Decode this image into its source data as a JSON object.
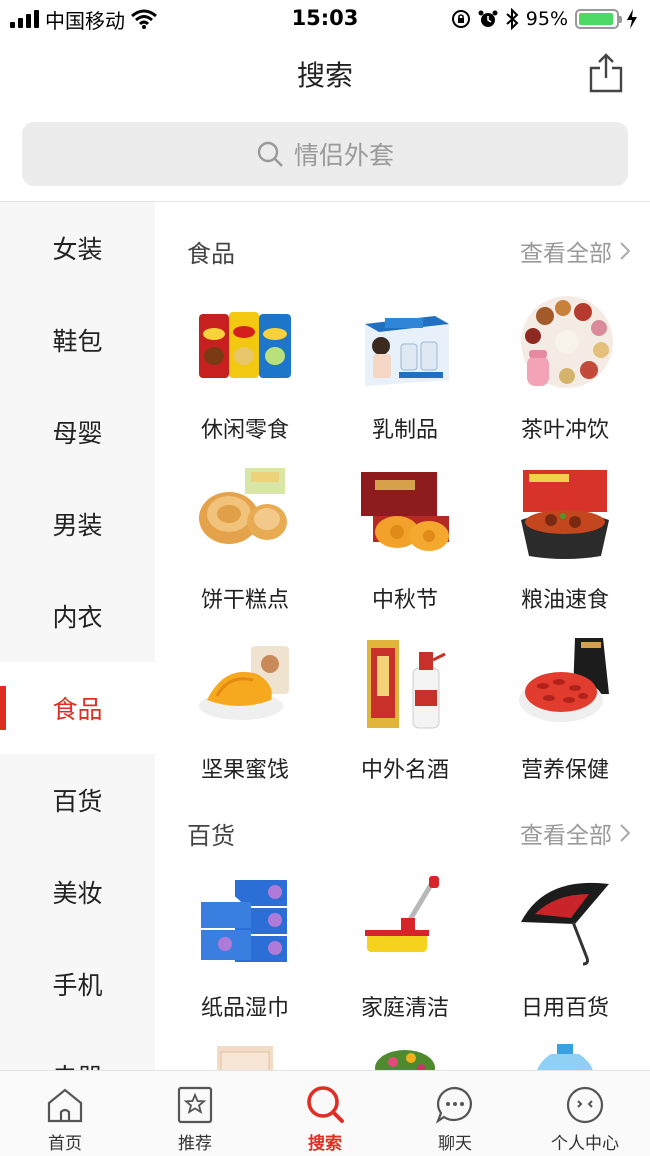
{
  "status_bar": {
    "carrier": "中国移动",
    "time": "15:03",
    "battery": "95%",
    "battery_level": 0.95
  },
  "nav": {
    "title": "搜索"
  },
  "search": {
    "placeholder": "情侣外套"
  },
  "sidebar": {
    "items": [
      {
        "label": "女装"
      },
      {
        "label": "鞋包"
      },
      {
        "label": "母婴"
      },
      {
        "label": "男装"
      },
      {
        "label": "内衣"
      },
      {
        "label": "食品"
      },
      {
        "label": "百货"
      },
      {
        "label": "美妆"
      },
      {
        "label": "手机"
      },
      {
        "label": "电器"
      }
    ],
    "active_index": 5
  },
  "sections": [
    {
      "title": "食品",
      "more": "查看全部",
      "items": [
        {
          "label": "休闲零食",
          "icon": "chips-bags"
        },
        {
          "label": "乳制品",
          "icon": "milk-box"
        },
        {
          "label": "茶叶冲饮",
          "icon": "tea-assortment"
        },
        {
          "label": "饼干糕点",
          "icon": "pastry-bread"
        },
        {
          "label": "中秋节",
          "icon": "mooncake-box"
        },
        {
          "label": "粮油速食",
          "icon": "instant-noodles"
        },
        {
          "label": "坚果蜜饯",
          "icon": "dried-mango"
        },
        {
          "label": "中外名酒",
          "icon": "liquor-bottle"
        },
        {
          "label": "营养保健",
          "icon": "goji-berries"
        }
      ]
    },
    {
      "title": "百货",
      "more": "查看全部",
      "items": [
        {
          "label": "纸品湿巾",
          "icon": "tissue-boxes"
        },
        {
          "label": "家庭清洁",
          "icon": "mop"
        },
        {
          "label": "日用百货",
          "icon": "umbrella"
        },
        {
          "label": "",
          "icon": "storage-drawer"
        },
        {
          "label": "",
          "icon": "plant-pot"
        },
        {
          "label": "",
          "icon": "water-bottle"
        }
      ]
    }
  ],
  "tabbar": {
    "items": [
      {
        "label": "首页",
        "icon": "home-icon"
      },
      {
        "label": "推荐",
        "icon": "star-bookmark-icon"
      },
      {
        "label": "搜索",
        "icon": "search-icon"
      },
      {
        "label": "聊天",
        "icon": "chat-bubble-icon"
      },
      {
        "label": "个人中心",
        "icon": "profile-face-icon"
      }
    ],
    "active_index": 2
  },
  "colors": {
    "accent": "#e02e24",
    "battery_green": "#4cd964"
  }
}
